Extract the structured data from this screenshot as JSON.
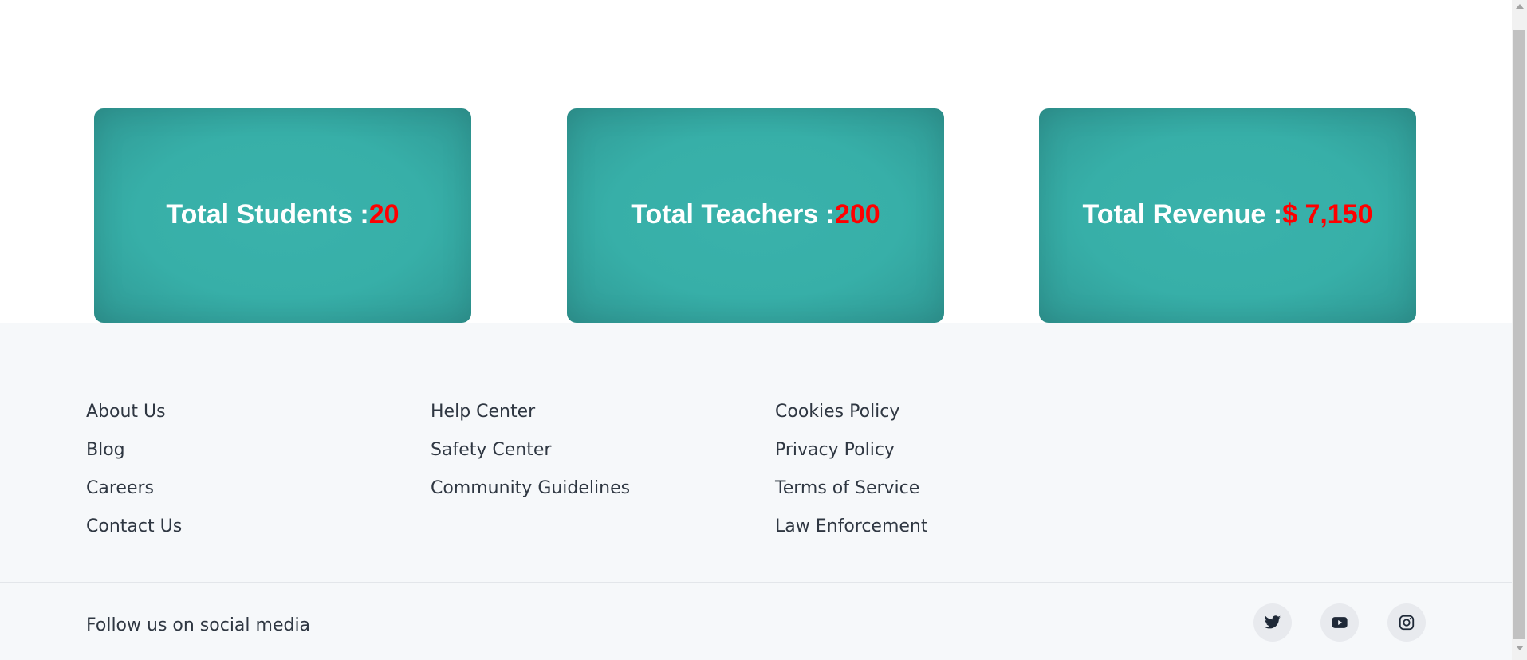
{
  "stats": {
    "cards": [
      {
        "label": "Total Students :",
        "value": "20"
      },
      {
        "label": "Total Teachers :",
        "value": "200"
      },
      {
        "label": "Total Revenue :",
        "value": "$ 7,150"
      }
    ]
  },
  "footer": {
    "columns": [
      {
        "links": [
          "About Us",
          "Blog",
          "Careers",
          "Contact Us"
        ]
      },
      {
        "links": [
          "Help Center",
          "Safety Center",
          "Community Guidelines"
        ]
      },
      {
        "links": [
          "Cookies Policy",
          "Privacy Policy",
          "Terms of Service",
          "Law Enforcement"
        ]
      }
    ],
    "follow_text": "Follow us on social media",
    "social_icons": [
      "twitter-icon",
      "youtube-icon",
      "instagram-icon"
    ]
  },
  "colors": {
    "card_background": "#37afa8",
    "card_label": "#ffffff",
    "card_value": "#ff0000",
    "footer_background": "#f6f8fa",
    "footer_text": "#2f3742"
  }
}
